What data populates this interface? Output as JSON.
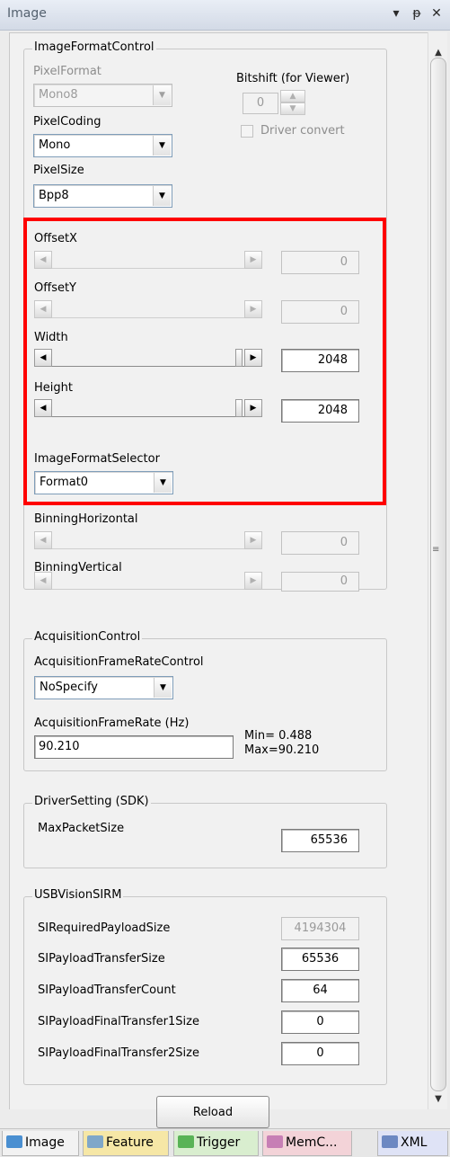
{
  "window": {
    "title": "Image",
    "buttons": [
      "▾",
      "ᵽ",
      "✕"
    ]
  },
  "image_format": {
    "group_title": "ImageFormatControl",
    "pixel_format_label": "PixelFormat",
    "pixel_format_value": "Mono8",
    "bitshift_label": "Bitshift (for Viewer)",
    "bitshift_value": "0",
    "driver_convert_label": "Driver convert",
    "pixel_coding_label": "PixelCoding",
    "pixel_coding_value": "Mono",
    "pixel_size_label": "PixelSize",
    "pixel_size_value": "Bpp8",
    "offset_x_label": "OffsetX",
    "offset_x_value": "0",
    "offset_y_label": "OffsetY",
    "offset_y_value": "0",
    "width_label": "Width",
    "width_value": "2048",
    "height_label": "Height",
    "height_value": "2048",
    "format_selector_label": "ImageFormatSelector",
    "format_selector_value": "Format0",
    "binning_h_label": "BinningHorizontal",
    "binning_h_value": "0",
    "binning_v_label": "BinningVertical",
    "binning_v_value": "0"
  },
  "acquisition": {
    "group_title": "AcquisitionControl",
    "rate_control_label": "AcquisitionFrameRateControl",
    "rate_control_value": "NoSpecify",
    "rate_label": "AcquisitionFrameRate (Hz)",
    "rate_value": "90.210",
    "min_text": "Min= 0.488",
    "max_text": "Max=90.210"
  },
  "driver": {
    "group_title": "DriverSetting (SDK)",
    "max_packet_label": "MaxPacketSize",
    "max_packet_value": "65536"
  },
  "usb": {
    "group_title": "USBVisionSIRM",
    "rows": [
      {
        "label": "SIRequiredPayloadSize",
        "value": "4194304"
      },
      {
        "label": "SIPayloadTransferSize",
        "value": "65536"
      },
      {
        "label": "SIPayloadTransferCount",
        "value": "64"
      },
      {
        "label": "SIPayloadFinalTransfer1Size",
        "value": "0"
      },
      {
        "label": "SIPayloadFinalTransfer2Size",
        "value": "0"
      }
    ]
  },
  "reload_label": "Reload",
  "tabs": [
    {
      "label": "Image",
      "color": "#4a8fd1"
    },
    {
      "label": "Feature",
      "color": "#7fa7c9"
    },
    {
      "label": "Trigger",
      "color": "#59b356"
    },
    {
      "label": "MemC...",
      "color": "#c77fb5"
    },
    {
      "label": "XML",
      "color": "#6c88c2"
    }
  ],
  "colors": {
    "highlight": "#ff0000",
    "tab_image": "#f2f2f2",
    "tab_feature": "#f6e7a6",
    "tab_trigger": "#d9eecf",
    "tab_memc": "#f3d3d8",
    "tab_xml": "#dfe3f6"
  }
}
